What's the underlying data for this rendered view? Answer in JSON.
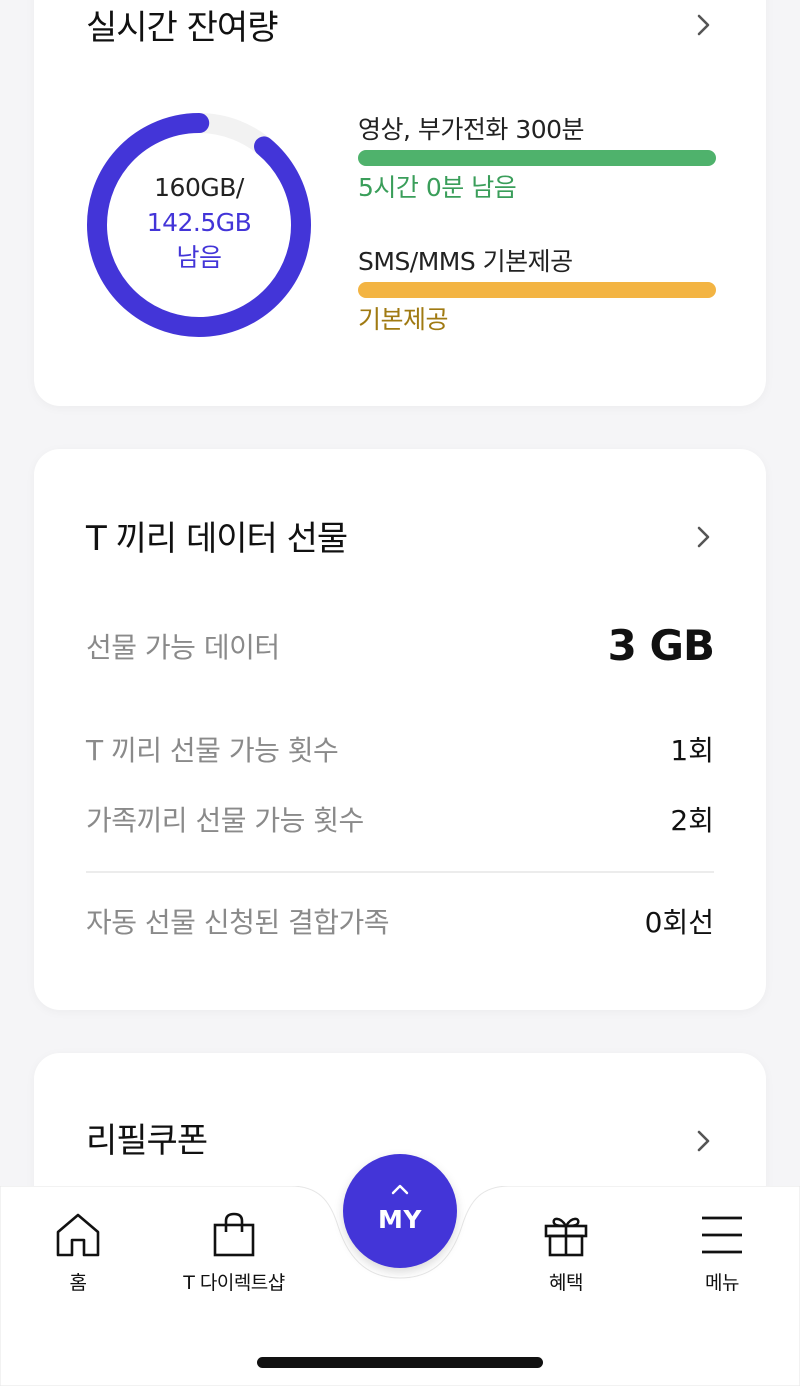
{
  "usage": {
    "title": "실시간 잔여량",
    "donut": {
      "total_text": "160GB/",
      "remain_value": "142.5GB",
      "remain_suffix": "남음",
      "remaining_fraction": 0.89
    },
    "plans": [
      {
        "name": "영상, 부가전화 300분",
        "status": "5시간 0분 남음",
        "color": "#4fb26c"
      },
      {
        "name": "SMS/MMS 기본제공",
        "status": "기본제공",
        "color": "#f3b443"
      }
    ]
  },
  "gift": {
    "title": "T 끼리 데이터 선물",
    "rows": [
      {
        "label": "선물 가능 데이터",
        "value": "3 GB"
      },
      {
        "label": "T 끼리 선물 가능 횟수",
        "value": "1회"
      },
      {
        "label": "가족끼리 선물 가능 횟수",
        "value": "2회"
      },
      {
        "label": "자동 선물 신청된 결합가족",
        "value": "0회선"
      }
    ]
  },
  "refill": {
    "title": "리필쿠폰"
  },
  "nav": {
    "home": "홈",
    "shop": "T 다이렉트샵",
    "my": "MY",
    "benefit": "혜택",
    "menu": "메뉴"
  },
  "colors": {
    "accent": "#4335d8",
    "voice_bar": "#4fb26c",
    "sms_bar": "#f3b443"
  }
}
